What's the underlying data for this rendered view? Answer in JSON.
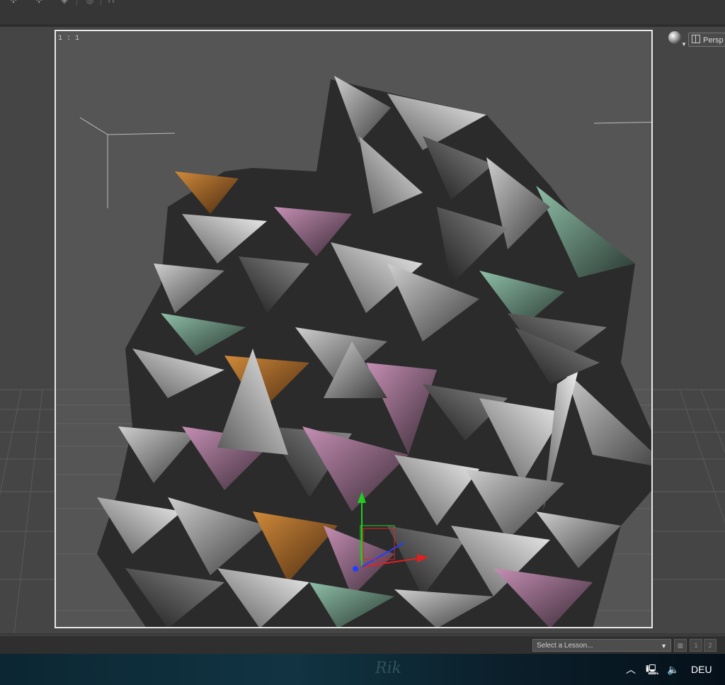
{
  "viewport": {
    "ratio_label": "1 : 1",
    "camera_label": "Persp"
  },
  "lesson": {
    "placeholder": "Select a Lesson...",
    "page_buttons": [
      "1",
      "2"
    ]
  },
  "taskbar": {
    "language": "DEU"
  },
  "colors": {
    "panel": "#363636",
    "viewport_bg": "#555555",
    "frame_border": "#e8e8e8",
    "gizmo_y": "#22cc22",
    "gizmo_x": "#e02020",
    "gizmo_z": "#2040ff"
  },
  "icons": [
    "rotate-icon",
    "move-icon",
    "scale-icon",
    "target-icon",
    "frame-icon",
    "camera-sphere-icon",
    "grid-icon",
    "movie-icon",
    "chevron-up-icon",
    "network-icon",
    "speaker-icon"
  ]
}
